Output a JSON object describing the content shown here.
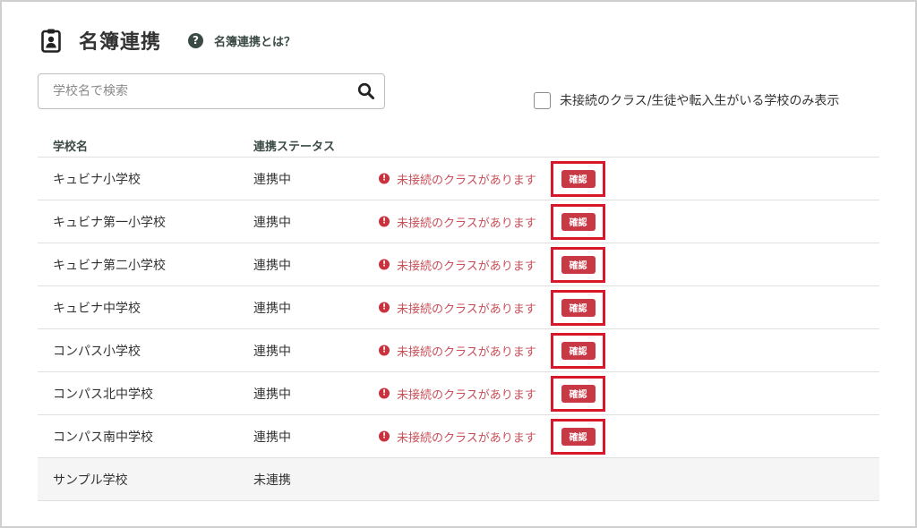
{
  "header": {
    "title": "名簿連携",
    "title_icon": "clipboard-user-icon",
    "help_icon": "question-circle-icon",
    "help_link": "名簿連携とは？"
  },
  "search": {
    "placeholder": "学校名で検索",
    "value": "",
    "icon": "search-icon"
  },
  "filter": {
    "label": "未接続のクラス/生徒や転入生がいる学校のみ表示",
    "checked": false
  },
  "table": {
    "headers": {
      "name": "学校名",
      "status": "連携ステータス"
    },
    "rows": [
      {
        "name": "キュビナ小学校",
        "status": "連携中",
        "warning": "未接続のクラスがあります",
        "action": "確認"
      },
      {
        "name": "キュビナ第一小学校",
        "status": "連携中",
        "warning": "未接続のクラスがあります",
        "action": "確認"
      },
      {
        "name": "キュビナ第二小学校",
        "status": "連携中",
        "warning": "未接続のクラスがあります",
        "action": "確認"
      },
      {
        "name": "キュビナ中学校",
        "status": "連携中",
        "warning": "未接続のクラスがあります",
        "action": "確認"
      },
      {
        "name": "コンパス小学校",
        "status": "連携中",
        "warning": "未接続のクラスがあります",
        "action": "確認"
      },
      {
        "name": "コンパス北中学校",
        "status": "連携中",
        "warning": "未接続のクラスがあります",
        "action": "確認"
      },
      {
        "name": "コンパス南中学校",
        "status": "連携中",
        "warning": "未接続のクラスがあります",
        "action": "確認"
      },
      {
        "name": "サンプル学校",
        "status": "未連携"
      }
    ]
  },
  "colors": {
    "accent_dark": "#3b4a44",
    "warning": "#c8323f",
    "highlight_border": "#d8182a"
  }
}
